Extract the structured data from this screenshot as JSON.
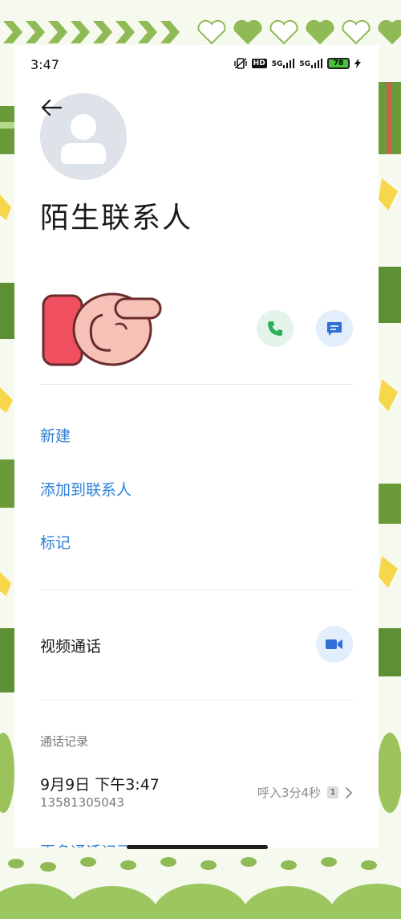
{
  "status_bar": {
    "time": "3:47",
    "hd_label": "HD",
    "signal1": "5G",
    "signal2": "5G",
    "battery": "78"
  },
  "contact": {
    "title": "陌生联系人"
  },
  "actions": {
    "new": "新建",
    "add_to_contacts": "添加到联系人",
    "mark": "标记"
  },
  "video": {
    "label": "视频通话"
  },
  "call_log": {
    "section_title": "通话记录",
    "entries": [
      {
        "date": "9月9日 下午3:47",
        "number": "13581305043",
        "info": "呼入3分4秒",
        "sim": "1"
      }
    ],
    "more": "更多通话记录"
  },
  "colors": {
    "link": "#2f7fd8",
    "call_green": "#2bb05a",
    "message_blue": "#2f6fd8",
    "frame_green": "#8fba55"
  }
}
